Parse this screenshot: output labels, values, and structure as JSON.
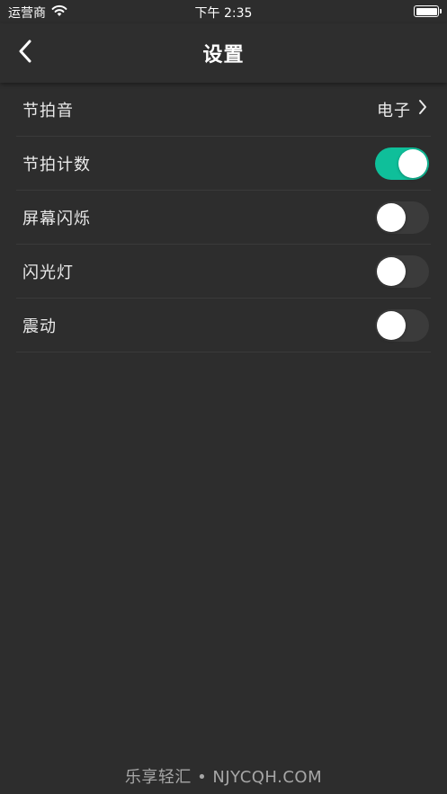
{
  "status_bar": {
    "carrier": "运营商",
    "time": "下午 2:35"
  },
  "nav": {
    "title": "设置",
    "back_icon": "chevron-left-icon"
  },
  "settings": {
    "beat_sound": {
      "label": "节拍音",
      "value": "电子"
    },
    "beat_count": {
      "label": "节拍计数",
      "enabled": true
    },
    "screen_flash": {
      "label": "屏幕闪烁",
      "enabled": false
    },
    "flashlight": {
      "label": "闪光灯",
      "enabled": false
    },
    "vibration": {
      "label": "震动",
      "enabled": false
    }
  },
  "colors": {
    "background": "#2d2d2d",
    "toggle_on": "#0fbf9a",
    "toggle_off": "#3b3b3b",
    "divider": "#3a3a3a"
  },
  "watermark": "乐享轻汇 • NJYCQH.COM"
}
